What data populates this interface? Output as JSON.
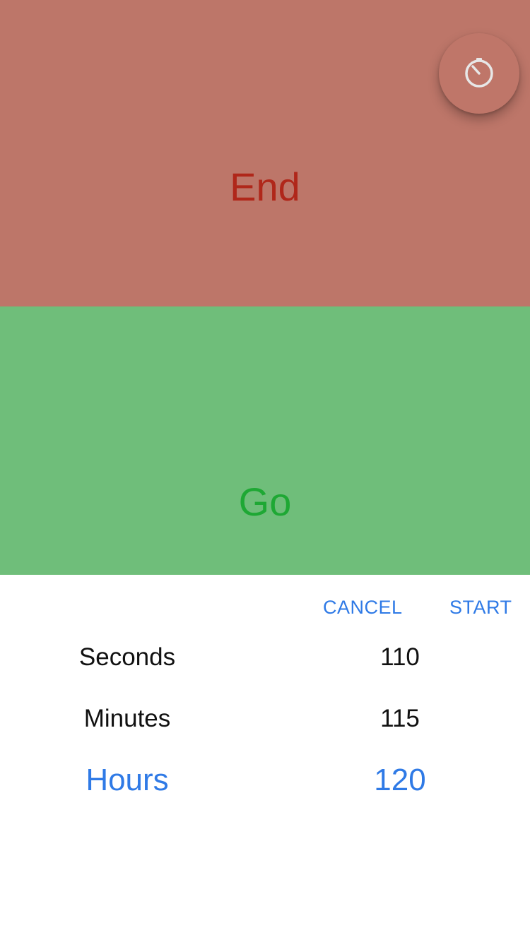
{
  "panels": {
    "end_label": "End",
    "go_label": "Go"
  },
  "fab": {
    "icon": "timer-icon"
  },
  "sheet": {
    "cancel_label": "CANCEL",
    "start_label": "START",
    "rows": [
      {
        "label": "Seconds",
        "value": "110",
        "selected": false
      },
      {
        "label": "Minutes",
        "value": "115",
        "selected": false
      },
      {
        "label": "Hours",
        "value": "120",
        "selected": true
      }
    ]
  },
  "colors": {
    "end_panel": "#bd7669",
    "end_text": "#b0271a",
    "go_panel": "#6fbe7a",
    "go_text": "#1ea834",
    "accent": "#2f7ae6"
  }
}
